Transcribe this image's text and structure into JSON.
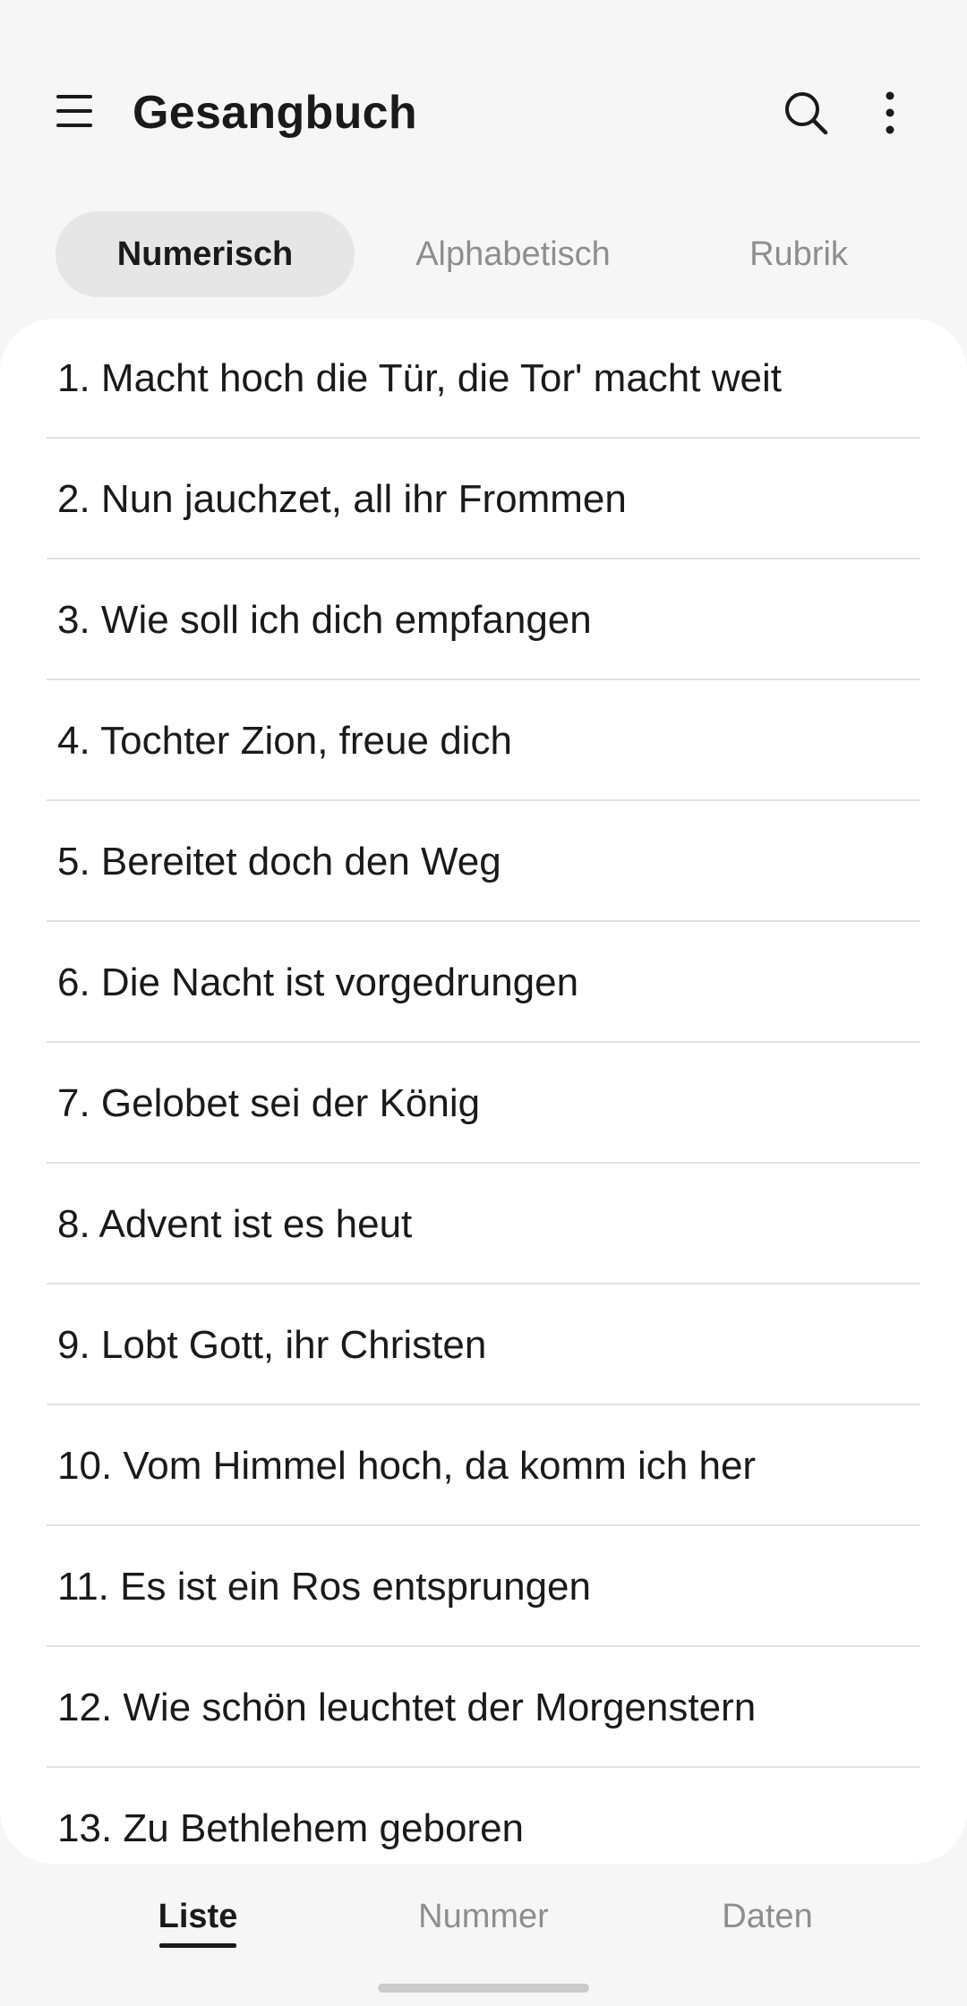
{
  "app_bar": {
    "title": "Gesangbuch",
    "menu_icon": "hamburger-menu-icon",
    "search_icon": "search-icon",
    "more_icon": "more-vertical-icon"
  },
  "tabs": [
    {
      "label": "Numerisch",
      "active": true
    },
    {
      "label": "Alphabetisch",
      "active": false
    },
    {
      "label": "Rubrik",
      "active": false
    }
  ],
  "songs": [
    "1. Macht hoch die Tür, die Tor' macht weit",
    "2. Nun jauchzet, all ihr Frommen",
    "3. Wie soll ich dich empfangen",
    "4. Tochter Zion, freue dich",
    "5. Bereitet doch den Weg",
    "6. Die Nacht ist vorgedrungen",
    "7. Gelobet sei der König",
    "8. Advent ist es heut",
    "9. Lobt Gott, ihr Christen",
    "10. Vom Himmel hoch, da komm ich her",
    "11. Es ist ein Ros entsprungen",
    "12. Wie schön leuchtet der Morgenstern",
    "13. Zu Bethlehem geboren"
  ],
  "bottom_nav": [
    {
      "label": "Liste",
      "active": true
    },
    {
      "label": "Nummer",
      "active": false
    },
    {
      "label": "Daten",
      "active": false
    }
  ],
  "colors": {
    "background": "#f6f6f6",
    "card": "#ffffff",
    "active_tab": "#e6e6e6",
    "text_primary": "#1a1a1a",
    "text_secondary": "#8e8e8e",
    "divider": "#e2e2e2"
  }
}
